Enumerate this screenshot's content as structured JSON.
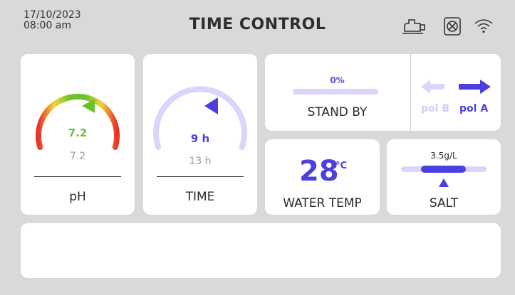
{
  "header": {
    "date": "17/10/2023",
    "time": "08:00 am",
    "title": "TIME CONTROL",
    "icons": [
      "pump-icon",
      "filter-icon",
      "wifi-icon"
    ]
  },
  "ph": {
    "value": "7.2",
    "setpoint": "7.2",
    "label": "pH",
    "value_color": "#6cc12c"
  },
  "time": {
    "value": "9 h",
    "setpoint": "13 h",
    "label": "TIME",
    "accent": "#4b3fe0"
  },
  "standby": {
    "percent": "0%",
    "level": 0,
    "label": "STAND BY"
  },
  "polarity": {
    "pol_b": "pol B",
    "pol_a": "pol A",
    "active": "pol A"
  },
  "water_temp": {
    "value": "28",
    "unit": "°C",
    "label": "WATER TEMP"
  },
  "salt": {
    "value": "3.5g/L",
    "label": "SALT"
  },
  "colors": {
    "background": "#d9d9d9",
    "card": "#ffffff",
    "accent": "#4b3fe0",
    "accent_light": "#d8d6fb",
    "ph_green": "#6cc12c"
  }
}
